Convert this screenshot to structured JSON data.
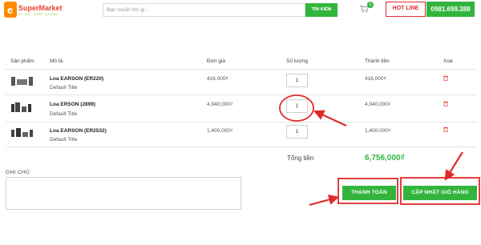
{
  "brand": {
    "name": "SuperMarket",
    "tagline": "UY TÍN · CHẤT LƯỢNG",
    "logo_letter": "e"
  },
  "header": {
    "search_placeholder": "Bạn muốn tìm gì...",
    "search_button": "TÌM KIẾM",
    "cart_count": "0",
    "hotline_label": "HOT LINE",
    "phone": "0981.699.388"
  },
  "cart": {
    "columns": [
      "Sản phẩm",
      "Mô tả",
      "Đơn giá",
      "Số lượng",
      "Thành tiền",
      "Xoá"
    ],
    "rows": [
      {
        "name": "Loa EARSON (ER220)",
        "variant": "Default Title",
        "price": "416,000₫",
        "qty": "1",
        "subtotal": "416,000₫"
      },
      {
        "name": "Loa ERSON (2899)",
        "variant": "Default Title",
        "price": "4,940,000₫",
        "qty": "1",
        "subtotal": "4,940,000₫"
      },
      {
        "name": "Loa EARSON (ER2532)",
        "variant": "Default Title",
        "price": "1,400,000₫",
        "qty": "1",
        "subtotal": "1,400,000₫"
      }
    ],
    "total_label": "Tổng tiền",
    "total_value": "6,756,000₫"
  },
  "note": {
    "label": "GHI CHÚ"
  },
  "actions": {
    "checkout": "THANH TOÁN",
    "update": "CẬP NHẬT GIỎ HÀNG"
  },
  "colors": {
    "accent_green": "#33b53d",
    "hotline_red": "#e02a2a",
    "annotation_red": "#e02a2a",
    "total_green": "#33b53d"
  },
  "icons": [
    "logo-icon",
    "cart-icon",
    "trash-icon"
  ]
}
